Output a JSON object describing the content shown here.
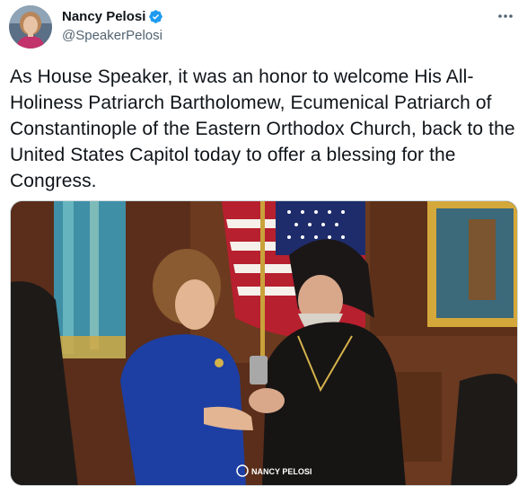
{
  "author": {
    "display_name": "Nancy Pelosi",
    "handle": "@SpeakerPelosi",
    "verified_icon": "verified-badge-icon",
    "avatar_icon": "profile-photo"
  },
  "tweet": {
    "text": "As House Speaker, it was an honor to welcome His All-Holiness Patriarch Bartholomew, Ecumenical Patriarch of Constantinople of the Eastern Orthodox Church, back to the United States Capitol today to offer a blessing for the Congress."
  },
  "media": {
    "watermark": "NANCY PELOSI"
  },
  "actions": {
    "more_icon": "more-options-icon"
  },
  "colors": {
    "accent": "#1d9bf0",
    "text": "#0f1419",
    "secondary": "#536471"
  }
}
